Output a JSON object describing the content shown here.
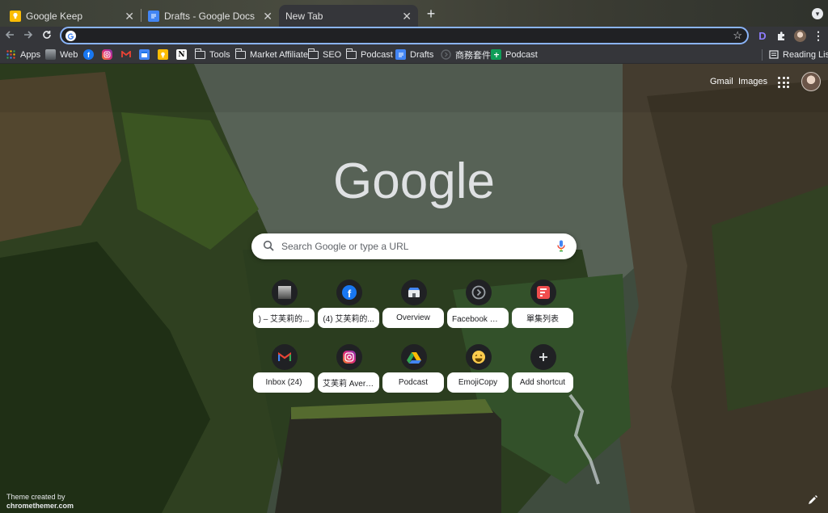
{
  "tabs": [
    {
      "title": "Google Keep",
      "icon": "keep-icon",
      "active": false
    },
    {
      "title": "Drafts - Google Docs",
      "icon": "docs-icon",
      "active": false
    },
    {
      "title": "New Tab",
      "icon": "",
      "active": true
    }
  ],
  "toolbar": {
    "omnibox_value": "",
    "extension_letter": "D"
  },
  "bookmarks": [
    {
      "label": "Apps",
      "icon": "apps-grid-icon"
    },
    {
      "label": "Web",
      "icon": "web-thumbnail-icon"
    },
    {
      "label": "",
      "icon": "facebook-icon"
    },
    {
      "label": "",
      "icon": "instagram-icon"
    },
    {
      "label": "",
      "icon": "gmail-icon"
    },
    {
      "label": "",
      "icon": "calendar-icon"
    },
    {
      "label": "",
      "icon": "keep-icon"
    },
    {
      "label": "",
      "icon": "notion-icon"
    },
    {
      "label": "Tools",
      "icon": "folder-icon"
    },
    {
      "label": "Market Affiliate",
      "icon": "folder-icon"
    },
    {
      "label": "SEO",
      "icon": "folder-icon"
    },
    {
      "label": "Podcast",
      "icon": "folder-icon"
    },
    {
      "label": "Drafts",
      "icon": "docs-icon"
    },
    {
      "label": "商務套件",
      "icon": "circle-arrow-icon"
    },
    {
      "label": "Podcast",
      "icon": "sheets-icon"
    }
  ],
  "reading_list": "Reading List",
  "ntp": {
    "gmail": "Gmail",
    "images": "Images",
    "logo": "Google",
    "search_placeholder": "Search Google or type a URL",
    "shortcuts": [
      {
        "label": ") – 艾芙莉的...",
        "icon": "thumbnail-icon"
      },
      {
        "label": "(4) 艾芙莉的...",
        "icon": "facebook-icon"
      },
      {
        "label": "Overview",
        "icon": "shop-icon"
      },
      {
        "label": "Facebook 商...",
        "icon": "circle-arrow-icon"
      },
      {
        "label": "單集列表",
        "icon": "flash-icon"
      },
      {
        "label": "Inbox (24)",
        "icon": "gmail-icon"
      },
      {
        "label": "艾芙莉 Avery ...",
        "icon": "instagram-icon"
      },
      {
        "label": "Podcast",
        "icon": "drive-icon"
      },
      {
        "label": "EmojiCopy",
        "icon": "emoji-icon"
      },
      {
        "label": "Add shortcut",
        "icon": "plus-icon"
      }
    ],
    "credit_line1": "Theme created by",
    "credit_line2": "chromethemer.com"
  },
  "colors": {
    "accent": "#8ab4f8",
    "toolbar": "#35363a",
    "omnibox_bg": "#202124",
    "tile_circle": "#202124"
  }
}
